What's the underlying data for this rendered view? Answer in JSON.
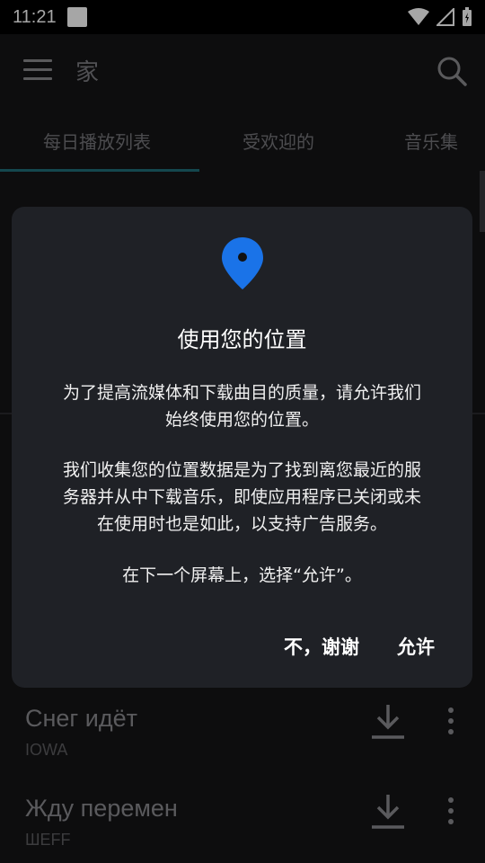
{
  "status_bar": {
    "time": "11:21"
  },
  "app_bar": {
    "title": "家"
  },
  "tabs": [
    {
      "label": "每日播放列表"
    },
    {
      "label": "受欢迎的"
    },
    {
      "label": "音乐集"
    }
  ],
  "songs": [
    {
      "title": "Снег идёт",
      "artist": "IOWA"
    },
    {
      "title": "Жду перемен",
      "artist": "ШEFF"
    }
  ],
  "dialog": {
    "title": "使用您的位置",
    "paragraph1_line1": "为了提高流媒体和下载曲目的质量，请允许我们",
    "paragraph1_line2": "始终使用您的位置。",
    "paragraph2_line1": "我们收集您的位置数据是为了找到离您最近的服",
    "paragraph2_line2": "务器并从中下载音乐，即使应用程序已关闭或未",
    "paragraph2_line3": "在使用时也是如此，以支持广告服务。",
    "paragraph3": "在下一个屏幕上，选择“允许”。",
    "deny_label": "不，谢谢",
    "allow_label": "允许"
  },
  "colors": {
    "accent_tab": "#1f6d79",
    "pin": "#1a73e8",
    "dialog_bg": "#1f2126"
  }
}
